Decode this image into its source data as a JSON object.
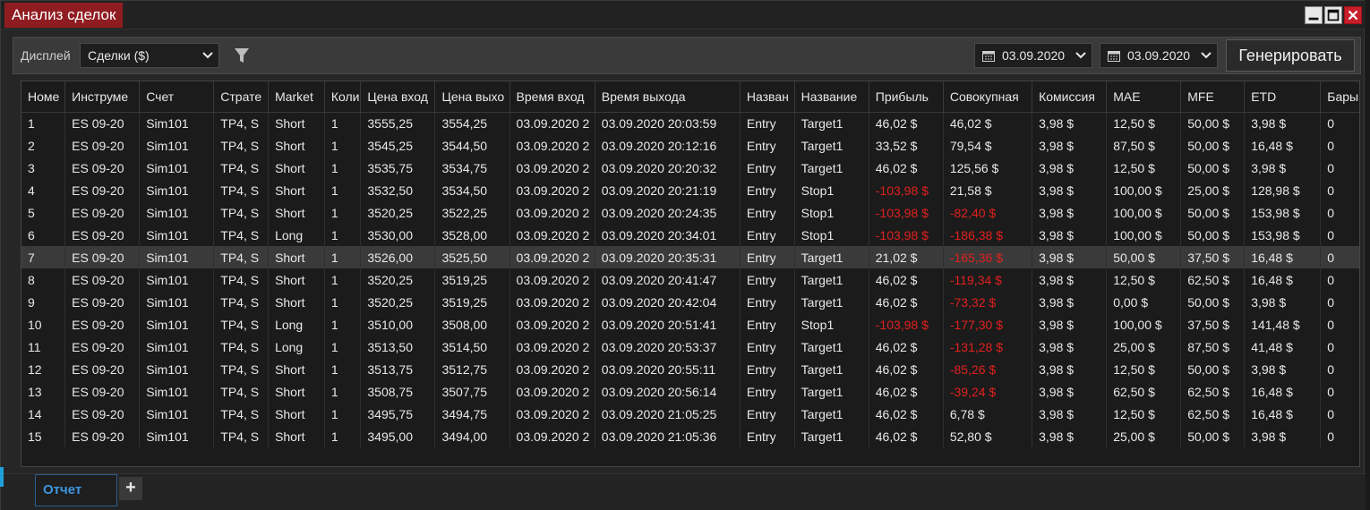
{
  "window": {
    "title": "Анализ сделок"
  },
  "toolbar": {
    "display_label": "Дисплей",
    "display_value": "Сделки ($)",
    "date_from": "03.09.2020",
    "date_to": "03.09.2020",
    "generate_label": "Генерировать"
  },
  "table": {
    "columns": [
      "Номе",
      "Инструме",
      "Счет",
      "Страте",
      "Market",
      "Коли",
      "Цена вход",
      "Цена выхо",
      "Время вход",
      "Время выхода",
      "Назван",
      "Название",
      "Прибыль",
      "Совокупная",
      "Комиссия",
      "MAE",
      "MFE",
      "ETD",
      "Бары"
    ],
    "rows": [
      [
        "1",
        "ES 09-20",
        "Sim101",
        "TP4, S",
        "Short",
        "1",
        "3555,25",
        "3554,25",
        "03.09.2020 2",
        "03.09.2020 20:03:59",
        "Entry",
        "Target1",
        "46,02 $",
        "46,02 $",
        "3,98 $",
        "12,50 $",
        "50,00 $",
        "3,98 $",
        "0"
      ],
      [
        "2",
        "ES 09-20",
        "Sim101",
        "TP4, S",
        "Short",
        "1",
        "3545,25",
        "3544,50",
        "03.09.2020 2",
        "03.09.2020 20:12:16",
        "Entry",
        "Target1",
        "33,52 $",
        "79,54 $",
        "3,98 $",
        "87,50 $",
        "50,00 $",
        "16,48 $",
        "0"
      ],
      [
        "3",
        "ES 09-20",
        "Sim101",
        "TP4, S",
        "Short",
        "1",
        "3535,75",
        "3534,75",
        "03.09.2020 2",
        "03.09.2020 20:20:32",
        "Entry",
        "Target1",
        "46,02 $",
        "125,56 $",
        "3,98 $",
        "12,50 $",
        "50,00 $",
        "3,98 $",
        "0"
      ],
      [
        "4",
        "ES 09-20",
        "Sim101",
        "TP4, S",
        "Short",
        "1",
        "3532,50",
        "3534,50",
        "03.09.2020 2",
        "03.09.2020 20:21:19",
        "Entry",
        "Stop1",
        "-103,98 $",
        "21,58 $",
        "3,98 $",
        "100,00 $",
        "25,00 $",
        "128,98 $",
        "0"
      ],
      [
        "5",
        "ES 09-20",
        "Sim101",
        "TP4, S",
        "Short",
        "1",
        "3520,25",
        "3522,25",
        "03.09.2020 2",
        "03.09.2020 20:24:35",
        "Entry",
        "Stop1",
        "-103,98 $",
        "-82,40 $",
        "3,98 $",
        "100,00 $",
        "50,00 $",
        "153,98 $",
        "0"
      ],
      [
        "6",
        "ES 09-20",
        "Sim101",
        "TP4, S",
        "Long",
        "1",
        "3530,00",
        "3528,00",
        "03.09.2020 2",
        "03.09.2020 20:34:01",
        "Entry",
        "Stop1",
        "-103,98 $",
        "-186,38 $",
        "3,98 $",
        "100,00 $",
        "50,00 $",
        "153,98 $",
        "0"
      ],
      [
        "7",
        "ES 09-20",
        "Sim101",
        "TP4, S",
        "Short",
        "1",
        "3526,00",
        "3525,50",
        "03.09.2020 2",
        "03.09.2020 20:35:31",
        "Entry",
        "Target1",
        "21,02 $",
        "-165,36 $",
        "3,98 $",
        "50,00 $",
        "37,50 $",
        "16,48 $",
        "0"
      ],
      [
        "8",
        "ES 09-20",
        "Sim101",
        "TP4, S",
        "Short",
        "1",
        "3520,25",
        "3519,25",
        "03.09.2020 2",
        "03.09.2020 20:41:47",
        "Entry",
        "Target1",
        "46,02 $",
        "-119,34 $",
        "3,98 $",
        "12,50 $",
        "62,50 $",
        "16,48 $",
        "0"
      ],
      [
        "9",
        "ES 09-20",
        "Sim101",
        "TP4, S",
        "Short",
        "1",
        "3520,25",
        "3519,25",
        "03.09.2020 2",
        "03.09.2020 20:42:04",
        "Entry",
        "Target1",
        "46,02 $",
        "-73,32 $",
        "3,98 $",
        "0,00 $",
        "50,00 $",
        "3,98 $",
        "0"
      ],
      [
        "10",
        "ES 09-20",
        "Sim101",
        "TP4, S",
        "Long",
        "1",
        "3510,00",
        "3508,00",
        "03.09.2020 2",
        "03.09.2020 20:51:41",
        "Entry",
        "Stop1",
        "-103,98 $",
        "-177,30 $",
        "3,98 $",
        "100,00 $",
        "37,50 $",
        "141,48 $",
        "0"
      ],
      [
        "11",
        "ES 09-20",
        "Sim101",
        "TP4, S",
        "Long",
        "1",
        "3513,50",
        "3514,50",
        "03.09.2020 2",
        "03.09.2020 20:53:37",
        "Entry",
        "Target1",
        "46,02 $",
        "-131,28 $",
        "3,98 $",
        "25,00 $",
        "87,50 $",
        "41,48 $",
        "0"
      ],
      [
        "12",
        "ES 09-20",
        "Sim101",
        "TP4, S",
        "Short",
        "1",
        "3513,75",
        "3512,75",
        "03.09.2020 2",
        "03.09.2020 20:55:11",
        "Entry",
        "Target1",
        "46,02 $",
        "-85,26 $",
        "3,98 $",
        "12,50 $",
        "50,00 $",
        "3,98 $",
        "0"
      ],
      [
        "13",
        "ES 09-20",
        "Sim101",
        "TP4, S",
        "Short",
        "1",
        "3508,75",
        "3507,75",
        "03.09.2020 2",
        "03.09.2020 20:56:14",
        "Entry",
        "Target1",
        "46,02 $",
        "-39,24 $",
        "3,98 $",
        "62,50 $",
        "62,50 $",
        "16,48 $",
        "0"
      ],
      [
        "14",
        "ES 09-20",
        "Sim101",
        "TP4, S",
        "Short",
        "1",
        "3495,75",
        "3494,75",
        "03.09.2020 2",
        "03.09.2020 21:05:25",
        "Entry",
        "Target1",
        "46,02 $",
        "6,78 $",
        "3,98 $",
        "12,50 $",
        "62,50 $",
        "16,48 $",
        "0"
      ],
      [
        "15",
        "ES 09-20",
        "Sim101",
        "TP4, S",
        "Short",
        "1",
        "3495,00",
        "3494,00",
        "03.09.2020 2",
        "03.09.2020 21:05:36",
        "Entry",
        "Target1",
        "46,02 $",
        "52,80 $",
        "3,98 $",
        "25,00 $",
        "50,00 $",
        "3,98 $",
        "0"
      ]
    ],
    "selected_row": 7
  },
  "tabs": {
    "active_label": "Отчет",
    "add_label": "+"
  },
  "colors": {
    "title_bg": "#8f1c21",
    "negative": "#e0201e",
    "tab_text": "#3d96e0",
    "close_btn": "#c8202a"
  },
  "icons": [
    "minimize-icon",
    "maximize-icon",
    "close-icon",
    "filter-icon",
    "calendar-icon",
    "chevron-down-icon"
  ]
}
